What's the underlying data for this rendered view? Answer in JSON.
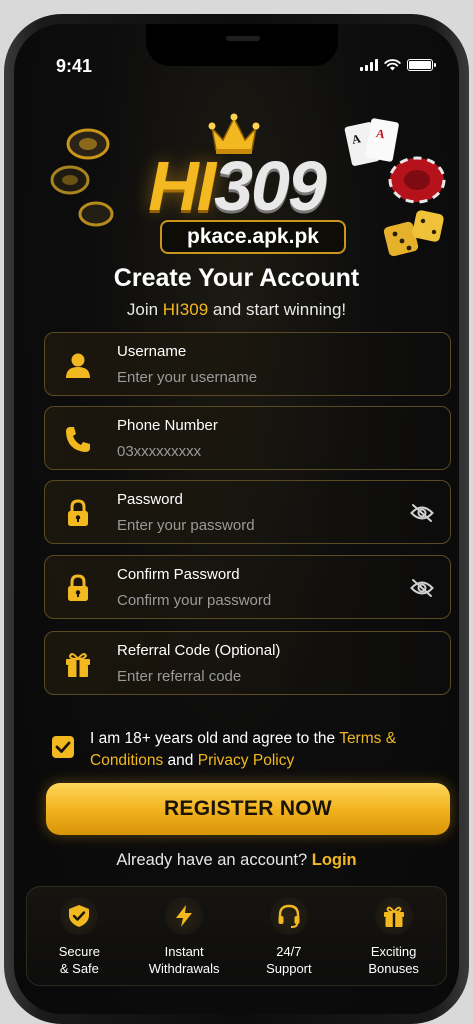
{
  "status_bar": {
    "time": "9:41"
  },
  "brand": {
    "logo_hi": "HI",
    "logo_num": "309",
    "domain": "pkace.apk.pk"
  },
  "header": {
    "title": "Create Your Account",
    "subtitle_prefix": "Join ",
    "subtitle_brand": "HI309",
    "subtitle_suffix": " and start winning!"
  },
  "form": {
    "username": {
      "label": "Username",
      "placeholder": "Enter your username"
    },
    "phone": {
      "label": "Phone Number",
      "placeholder": "03xxxxxxxxx"
    },
    "password": {
      "label": "Password",
      "placeholder": "Enter your password"
    },
    "confirm_password": {
      "label": "Confirm Password",
      "placeholder": "Confirm your password"
    },
    "referral": {
      "label": "Referral Code (Optional)",
      "placeholder": "Enter referral code"
    }
  },
  "terms": {
    "checked": true,
    "text_before": "I am 18+ years old and agree to the ",
    "terms_link": "Terms & Conditions",
    "and": " and ",
    "privacy_link": "Privacy Policy"
  },
  "register_label": "REGISTER NOW",
  "login": {
    "prompt": "Already have an account? ",
    "link": "Login"
  },
  "features": [
    {
      "line1": "Secure",
      "line2": "& Safe",
      "icon": "shield-check-icon"
    },
    {
      "line1": "Instant",
      "line2": "Withdrawals",
      "icon": "lightning-icon"
    },
    {
      "line1": "24/7",
      "line2": "Support",
      "icon": "headset-icon"
    },
    {
      "line1": "Exciting",
      "line2": "Bonuses",
      "icon": "gift-icon"
    }
  ],
  "colors": {
    "accent": "#f2b81f",
    "background": "#0d0d0d",
    "field_border": "#5a4a22"
  }
}
